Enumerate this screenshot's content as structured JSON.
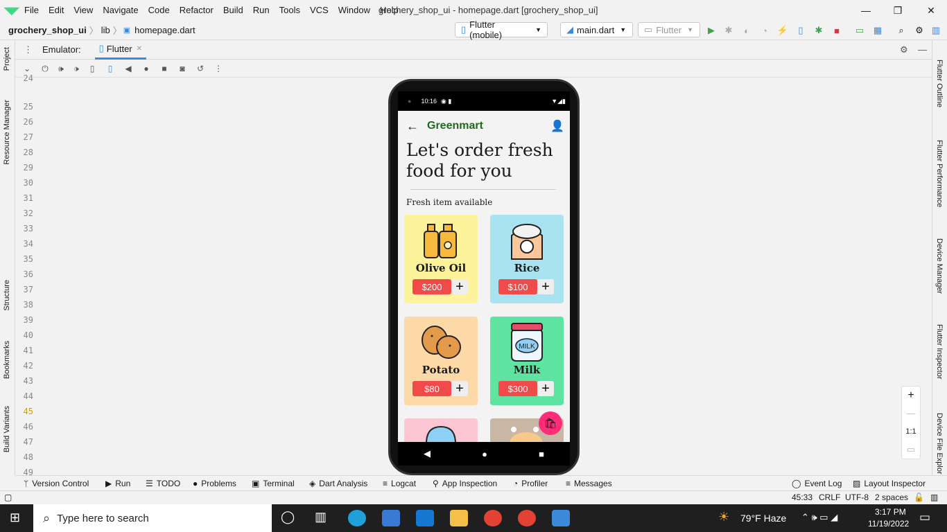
{
  "menu": [
    "File",
    "Edit",
    "View",
    "Navigate",
    "Code",
    "Refactor",
    "Build",
    "Run",
    "Tools",
    "VCS",
    "Window",
    "Help"
  ],
  "window_title": "grochery_shop_ui - homepage.dart [grochery_shop_ui]",
  "breadcrumb": {
    "project": "grochery_shop_ui",
    "folder": "lib",
    "file": "homepage.dart"
  },
  "toolbar": {
    "device": "Flutter (mobile)",
    "config": "main.dart",
    "target": "Flutter"
  },
  "emulator": {
    "label": "Emulator:",
    "tab": "Flutter"
  },
  "left_tools": [
    "Project",
    "Resource Manager",
    "Structure",
    "Bookmarks",
    "Build Variants"
  ],
  "right_tools": [
    "Flutter Outline",
    "Flutter Performance",
    "Device Manager",
    "Flutter Inspector",
    "Device File Explor"
  ],
  "line_numbers": [
    "24",
    "25",
    "26",
    "27",
    "28",
    "29",
    "30",
    "31",
    "32",
    "33",
    "34",
    "35",
    "36",
    "37",
    "38",
    "39",
    "40",
    "41",
    "42",
    "43",
    "44",
    "45",
    "46",
    "47",
    "48",
    "49"
  ],
  "phone": {
    "time": "10:16",
    "brand": "Greenmart",
    "headline_1": "Let's order fresh",
    "headline_2": "food for you",
    "subheading": "Fresh item available",
    "items": [
      {
        "name": "Olive Oil",
        "price": "$200",
        "color": "#fdf39a"
      },
      {
        "name": "Rice",
        "price": "$100",
        "color": "#a9e3ef"
      },
      {
        "name": "Potato",
        "price": "$80",
        "color": "#fdd9a8"
      },
      {
        "name": "Milk",
        "price": "$300",
        "color": "#5fe3a1"
      }
    ],
    "fab_color": "#ff2d77"
  },
  "zoom": {
    "plus": "+",
    "minus": "—",
    "ratio": "1:1"
  },
  "bottom_tabs": [
    "Version Control",
    "Run",
    "TODO",
    "Problems",
    "Terminal",
    "Dart Analysis",
    "Logcat",
    "App Inspection",
    "Profiler",
    "Messages"
  ],
  "bottom_right_tabs": [
    "Event Log",
    "Layout Inspector"
  ],
  "status": {
    "position": "45:33",
    "line_sep": "CRLF",
    "encoding": "UTF-8",
    "indent": "2 spaces"
  },
  "taskbar": {
    "search_placeholder": "Type here to search",
    "weather": "79°F  Haze",
    "time": "3:17 PM",
    "date": "11/19/2022"
  }
}
